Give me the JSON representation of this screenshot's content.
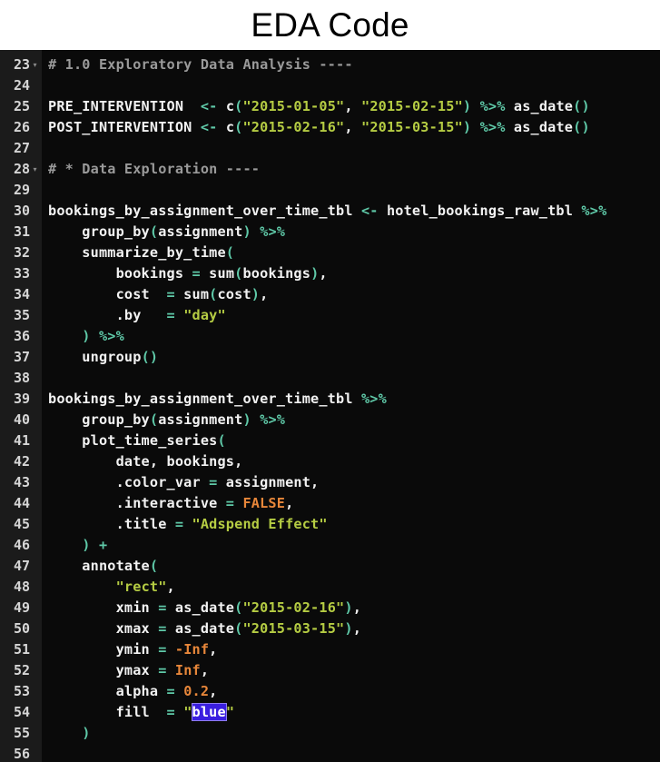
{
  "header": {
    "title": "EDA Code"
  },
  "editor": {
    "language": "R",
    "background_color": "#0a0a0a",
    "gutter_color": "#1b1b1b",
    "colors": {
      "plain": "#f2f2f2",
      "comment": "#9a9a9a",
      "string": "#b5cc43",
      "punctuation": "#5fc9a8",
      "operator": "#5fc9a8",
      "constant": "#e8873a",
      "number": "#e8873a",
      "selection_background": "#3a1ee0",
      "selection_text": "#ffffff",
      "line_number": "#d6d6d6"
    },
    "fold_marker": "▾",
    "first_line": 23,
    "last_line": 56,
    "selected_text": "blue",
    "lines": [
      {
        "number": "23",
        "fold": true,
        "tokens": [
          {
            "t": "# 1.0 Exploratory Data Analysis ----",
            "c": "comment"
          }
        ]
      },
      {
        "number": "24",
        "fold": false,
        "tokens": []
      },
      {
        "number": "25",
        "fold": false,
        "tokens": [
          {
            "t": "PRE_INTERVENTION  ",
            "c": "plain"
          },
          {
            "t": "<-",
            "c": "op"
          },
          {
            "t": " ",
            "c": "plain"
          },
          {
            "t": "c",
            "c": "plain"
          },
          {
            "t": "(",
            "c": "punct"
          },
          {
            "t": "\"2015-01-05\"",
            "c": "string"
          },
          {
            "t": ", ",
            "c": "plain"
          },
          {
            "t": "\"2015-02-15\"",
            "c": "string"
          },
          {
            "t": ")",
            "c": "punct"
          },
          {
            "t": " ",
            "c": "plain"
          },
          {
            "t": "%>%",
            "c": "op"
          },
          {
            "t": " as_date",
            "c": "plain"
          },
          {
            "t": "()",
            "c": "punct"
          }
        ]
      },
      {
        "number": "26",
        "fold": false,
        "tokens": [
          {
            "t": "POST_INTERVENTION ",
            "c": "plain"
          },
          {
            "t": "<-",
            "c": "op"
          },
          {
            "t": " ",
            "c": "plain"
          },
          {
            "t": "c",
            "c": "plain"
          },
          {
            "t": "(",
            "c": "punct"
          },
          {
            "t": "\"2015-02-16\"",
            "c": "string"
          },
          {
            "t": ", ",
            "c": "plain"
          },
          {
            "t": "\"2015-03-15\"",
            "c": "string"
          },
          {
            "t": ")",
            "c": "punct"
          },
          {
            "t": " ",
            "c": "plain"
          },
          {
            "t": "%>%",
            "c": "op"
          },
          {
            "t": " as_date",
            "c": "plain"
          },
          {
            "t": "()",
            "c": "punct"
          }
        ]
      },
      {
        "number": "27",
        "fold": false,
        "tokens": []
      },
      {
        "number": "28",
        "fold": true,
        "tokens": [
          {
            "t": "# * Data Exploration ----",
            "c": "comment"
          }
        ]
      },
      {
        "number": "29",
        "fold": false,
        "tokens": []
      },
      {
        "number": "30",
        "fold": false,
        "tokens": [
          {
            "t": "bookings_by_assignment_over_time_tbl ",
            "c": "plain"
          },
          {
            "t": "<-",
            "c": "op"
          },
          {
            "t": " hotel_bookings_raw_tbl ",
            "c": "plain"
          },
          {
            "t": "%>%",
            "c": "op"
          }
        ]
      },
      {
        "number": "31",
        "fold": false,
        "tokens": [
          {
            "t": "    group_by",
            "c": "plain"
          },
          {
            "t": "(",
            "c": "punct"
          },
          {
            "t": "assignment",
            "c": "plain"
          },
          {
            "t": ")",
            "c": "punct"
          },
          {
            "t": " ",
            "c": "plain"
          },
          {
            "t": "%>%",
            "c": "op"
          }
        ]
      },
      {
        "number": "32",
        "fold": false,
        "tokens": [
          {
            "t": "    summarize_by_time",
            "c": "plain"
          },
          {
            "t": "(",
            "c": "punct"
          }
        ]
      },
      {
        "number": "33",
        "fold": false,
        "tokens": [
          {
            "t": "        bookings ",
            "c": "plain"
          },
          {
            "t": "=",
            "c": "op"
          },
          {
            "t": " sum",
            "c": "plain"
          },
          {
            "t": "(",
            "c": "punct"
          },
          {
            "t": "bookings",
            "c": "plain"
          },
          {
            "t": ")",
            "c": "punct"
          },
          {
            "t": ",",
            "c": "plain"
          }
        ]
      },
      {
        "number": "34",
        "fold": false,
        "tokens": [
          {
            "t": "        cost  ",
            "c": "plain"
          },
          {
            "t": "=",
            "c": "op"
          },
          {
            "t": " sum",
            "c": "plain"
          },
          {
            "t": "(",
            "c": "punct"
          },
          {
            "t": "cost",
            "c": "plain"
          },
          {
            "t": ")",
            "c": "punct"
          },
          {
            "t": ",",
            "c": "plain"
          }
        ]
      },
      {
        "number": "35",
        "fold": false,
        "tokens": [
          {
            "t": "        .by   ",
            "c": "plain"
          },
          {
            "t": "=",
            "c": "op"
          },
          {
            "t": " ",
            "c": "plain"
          },
          {
            "t": "\"day\"",
            "c": "string"
          }
        ]
      },
      {
        "number": "36",
        "fold": false,
        "tokens": [
          {
            "t": "    ",
            "c": "plain"
          },
          {
            "t": ")",
            "c": "punct"
          },
          {
            "t": " ",
            "c": "plain"
          },
          {
            "t": "%>%",
            "c": "op"
          }
        ]
      },
      {
        "number": "37",
        "fold": false,
        "tokens": [
          {
            "t": "    ungroup",
            "c": "plain"
          },
          {
            "t": "()",
            "c": "punct"
          }
        ]
      },
      {
        "number": "38",
        "fold": false,
        "tokens": []
      },
      {
        "number": "39",
        "fold": false,
        "tokens": [
          {
            "t": "bookings_by_assignment_over_time_tbl ",
            "c": "plain"
          },
          {
            "t": "%>%",
            "c": "op"
          }
        ]
      },
      {
        "number": "40",
        "fold": false,
        "tokens": [
          {
            "t": "    group_by",
            "c": "plain"
          },
          {
            "t": "(",
            "c": "punct"
          },
          {
            "t": "assignment",
            "c": "plain"
          },
          {
            "t": ")",
            "c": "punct"
          },
          {
            "t": " ",
            "c": "plain"
          },
          {
            "t": "%>%",
            "c": "op"
          }
        ]
      },
      {
        "number": "41",
        "fold": false,
        "tokens": [
          {
            "t": "    plot_time_series",
            "c": "plain"
          },
          {
            "t": "(",
            "c": "punct"
          }
        ]
      },
      {
        "number": "42",
        "fold": false,
        "tokens": [
          {
            "t": "        date, bookings,",
            "c": "plain"
          }
        ]
      },
      {
        "number": "43",
        "fold": false,
        "tokens": [
          {
            "t": "        .color_var ",
            "c": "plain"
          },
          {
            "t": "=",
            "c": "op"
          },
          {
            "t": " assignment,",
            "c": "plain"
          }
        ]
      },
      {
        "number": "44",
        "fold": false,
        "tokens": [
          {
            "t": "        .interactive ",
            "c": "plain"
          },
          {
            "t": "=",
            "c": "op"
          },
          {
            "t": " ",
            "c": "plain"
          },
          {
            "t": "FALSE",
            "c": "const"
          },
          {
            "t": ",",
            "c": "plain"
          }
        ]
      },
      {
        "number": "45",
        "fold": false,
        "tokens": [
          {
            "t": "        .title ",
            "c": "plain"
          },
          {
            "t": "=",
            "c": "op"
          },
          {
            "t": " ",
            "c": "plain"
          },
          {
            "t": "\"Adspend Effect\"",
            "c": "string"
          }
        ]
      },
      {
        "number": "46",
        "fold": false,
        "tokens": [
          {
            "t": "    ",
            "c": "plain"
          },
          {
            "t": ")",
            "c": "punct"
          },
          {
            "t": " ",
            "c": "plain"
          },
          {
            "t": "+",
            "c": "op"
          }
        ]
      },
      {
        "number": "47",
        "fold": false,
        "tokens": [
          {
            "t": "    annotate",
            "c": "plain"
          },
          {
            "t": "(",
            "c": "punct"
          }
        ]
      },
      {
        "number": "48",
        "fold": false,
        "tokens": [
          {
            "t": "        ",
            "c": "plain"
          },
          {
            "t": "\"rect\"",
            "c": "string"
          },
          {
            "t": ",",
            "c": "plain"
          }
        ]
      },
      {
        "number": "49",
        "fold": false,
        "tokens": [
          {
            "t": "        xmin ",
            "c": "plain"
          },
          {
            "t": "=",
            "c": "op"
          },
          {
            "t": " as_date",
            "c": "plain"
          },
          {
            "t": "(",
            "c": "punct"
          },
          {
            "t": "\"2015-02-16\"",
            "c": "string"
          },
          {
            "t": ")",
            "c": "punct"
          },
          {
            "t": ",",
            "c": "plain"
          }
        ]
      },
      {
        "number": "50",
        "fold": false,
        "tokens": [
          {
            "t": "        xmax ",
            "c": "plain"
          },
          {
            "t": "=",
            "c": "op"
          },
          {
            "t": " as_date",
            "c": "plain"
          },
          {
            "t": "(",
            "c": "punct"
          },
          {
            "t": "\"2015-03-15\"",
            "c": "string"
          },
          {
            "t": ")",
            "c": "punct"
          },
          {
            "t": ",",
            "c": "plain"
          }
        ]
      },
      {
        "number": "51",
        "fold": false,
        "tokens": [
          {
            "t": "        ymin ",
            "c": "plain"
          },
          {
            "t": "=",
            "c": "op"
          },
          {
            "t": " ",
            "c": "plain"
          },
          {
            "t": "-Inf",
            "c": "const"
          },
          {
            "t": ",",
            "c": "plain"
          }
        ]
      },
      {
        "number": "52",
        "fold": false,
        "tokens": [
          {
            "t": "        ymax ",
            "c": "plain"
          },
          {
            "t": "=",
            "c": "op"
          },
          {
            "t": " ",
            "c": "plain"
          },
          {
            "t": "Inf",
            "c": "const"
          },
          {
            "t": ",",
            "c": "plain"
          }
        ]
      },
      {
        "number": "53",
        "fold": false,
        "tokens": [
          {
            "t": "        alpha ",
            "c": "plain"
          },
          {
            "t": "=",
            "c": "op"
          },
          {
            "t": " ",
            "c": "plain"
          },
          {
            "t": "0.2",
            "c": "num"
          },
          {
            "t": ",",
            "c": "plain"
          }
        ]
      },
      {
        "number": "54",
        "fold": false,
        "tokens": [
          {
            "t": "        fill  ",
            "c": "plain"
          },
          {
            "t": "=",
            "c": "op"
          },
          {
            "t": " ",
            "c": "plain"
          },
          {
            "t": "\"",
            "c": "string"
          },
          {
            "t": "blue",
            "c": "sel"
          },
          {
            "t": "\"",
            "c": "string"
          }
        ]
      },
      {
        "number": "55",
        "fold": false,
        "tokens": [
          {
            "t": "    ",
            "c": "plain"
          },
          {
            "t": ")",
            "c": "punct"
          }
        ]
      },
      {
        "number": "56",
        "fold": false,
        "tokens": []
      }
    ]
  }
}
